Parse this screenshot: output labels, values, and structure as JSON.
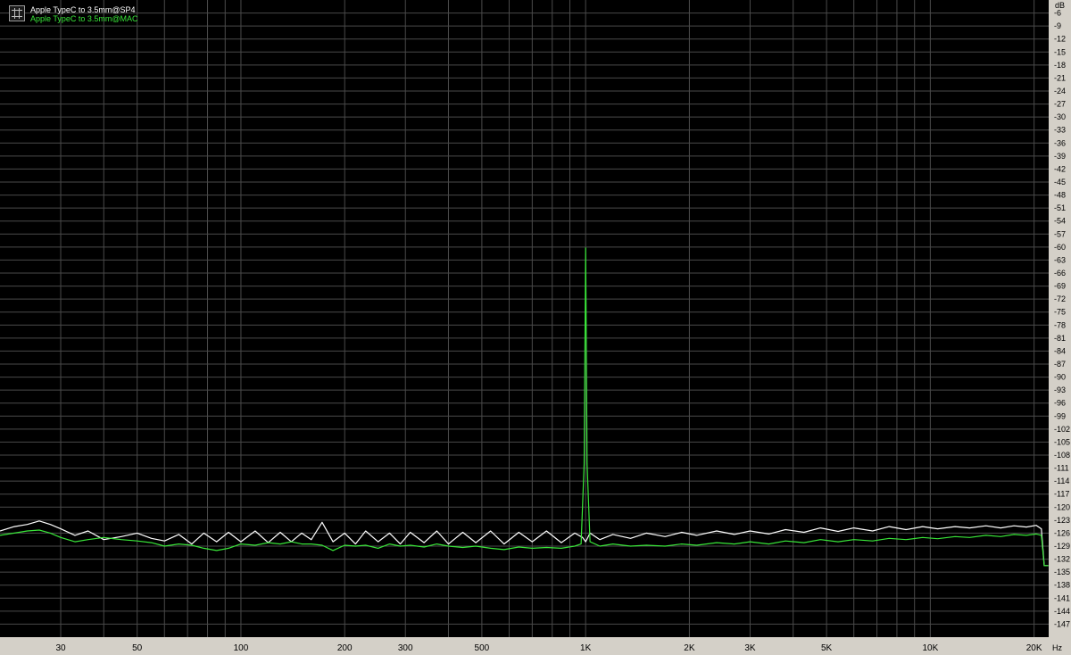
{
  "chart_data": {
    "type": "line",
    "title": "",
    "xlabel": "",
    "ylabel": "",
    "x_scale": "log",
    "xlim": [
      20,
      22050
    ],
    "ylim": [
      -150,
      -3
    ],
    "y_unit": "dB",
    "x_unit": "Hz",
    "grid": true,
    "legend": "top-left",
    "background": "#000000",
    "y_ticks": [
      -6,
      -9,
      -12,
      -15,
      -18,
      -21,
      -24,
      -27,
      -30,
      -33,
      -36,
      -39,
      -42,
      -45,
      -48,
      -51,
      -54,
      -57,
      -60,
      -63,
      -66,
      -69,
      -72,
      -75,
      -78,
      -81,
      -84,
      -87,
      -90,
      -93,
      -96,
      -99,
      -102,
      -105,
      -108,
      -111,
      -114,
      -117,
      -120,
      -123,
      -126,
      -129,
      -132,
      -135,
      -138,
      -141,
      -144,
      -147
    ],
    "x_ticks": [
      {
        "value": 30,
        "label": "30"
      },
      {
        "value": 50,
        "label": "50"
      },
      {
        "value": 100,
        "label": "100"
      },
      {
        "value": 200,
        "label": "200"
      },
      {
        "value": 300,
        "label": "300"
      },
      {
        "value": 500,
        "label": "500"
      },
      {
        "value": 1000,
        "label": "1K"
      },
      {
        "value": 2000,
        "label": "2K"
      },
      {
        "value": 3000,
        "label": "3K"
      },
      {
        "value": 5000,
        "label": "5K"
      },
      {
        "value": 10000,
        "label": "10K"
      },
      {
        "value": 20000,
        "label": "20K"
      }
    ],
    "series": [
      {
        "name": "Apple TypeC to 3.5mm@SP4",
        "color": "#ffffff",
        "points": [
          [
            20,
            -125.5
          ],
          [
            22,
            -124.5
          ],
          [
            24,
            -124
          ],
          [
            26,
            -123.2
          ],
          [
            28,
            -124
          ],
          [
            30,
            -125
          ],
          [
            33,
            -126.5
          ],
          [
            36,
            -125.5
          ],
          [
            40,
            -127.5
          ],
          [
            45,
            -126.8
          ],
          [
            50,
            -126
          ],
          [
            55,
            -127.2
          ],
          [
            60,
            -127.8
          ],
          [
            66,
            -126.3
          ],
          [
            72,
            -128.5
          ],
          [
            78,
            -126
          ],
          [
            85,
            -128
          ],
          [
            92,
            -125.8
          ],
          [
            100,
            -128
          ],
          [
            110,
            -125.5
          ],
          [
            120,
            -128.2
          ],
          [
            130,
            -125.8
          ],
          [
            140,
            -128
          ],
          [
            150,
            -126
          ],
          [
            160,
            -127.5
          ],
          [
            172,
            -123.5
          ],
          [
            185,
            -128
          ],
          [
            200,
            -126
          ],
          [
            215,
            -128.5
          ],
          [
            230,
            -125.5
          ],
          [
            250,
            -128
          ],
          [
            270,
            -126
          ],
          [
            290,
            -128.5
          ],
          [
            310,
            -125.8
          ],
          [
            340,
            -128.2
          ],
          [
            370,
            -125.5
          ],
          [
            400,
            -128.5
          ],
          [
            440,
            -125.8
          ],
          [
            480,
            -128.2
          ],
          [
            530,
            -125.5
          ],
          [
            580,
            -128.5
          ],
          [
            640,
            -125.8
          ],
          [
            700,
            -128
          ],
          [
            770,
            -125.5
          ],
          [
            850,
            -128.2
          ],
          [
            930,
            -126
          ],
          [
            980,
            -127
          ],
          [
            1000,
            -128
          ],
          [
            1030,
            -126
          ],
          [
            1100,
            -127.5
          ],
          [
            1200,
            -126.3
          ],
          [
            1350,
            -127.2
          ],
          [
            1500,
            -126
          ],
          [
            1700,
            -126.8
          ],
          [
            1900,
            -125.8
          ],
          [
            2100,
            -126.5
          ],
          [
            2400,
            -125.5
          ],
          [
            2700,
            -126.3
          ],
          [
            3000,
            -125.5
          ],
          [
            3400,
            -126.2
          ],
          [
            3800,
            -125.2
          ],
          [
            4300,
            -125.8
          ],
          [
            4800,
            -124.8
          ],
          [
            5400,
            -125.6
          ],
          [
            6000,
            -124.8
          ],
          [
            6800,
            -125.5
          ],
          [
            7600,
            -124.5
          ],
          [
            8500,
            -125.2
          ],
          [
            9500,
            -124.5
          ],
          [
            10500,
            -125
          ],
          [
            11800,
            -124.5
          ],
          [
            13000,
            -124.8
          ],
          [
            14500,
            -124.3
          ],
          [
            16000,
            -124.8
          ],
          [
            17500,
            -124.3
          ],
          [
            19000,
            -124.6
          ],
          [
            20300,
            -124.2
          ],
          [
            21000,
            -125
          ],
          [
            21400,
            -133.5
          ],
          [
            22000,
            -133.5
          ]
        ]
      },
      {
        "name": "Apple TypeC to 3.5mm@MAC",
        "color": "#39e639",
        "points": [
          [
            20,
            -126.5
          ],
          [
            22,
            -126
          ],
          [
            24,
            -125.5
          ],
          [
            26,
            -125.3
          ],
          [
            28,
            -126
          ],
          [
            30,
            -127
          ],
          [
            33,
            -128
          ],
          [
            36,
            -127.5
          ],
          [
            40,
            -127
          ],
          [
            45,
            -127.5
          ],
          [
            50,
            -127.8
          ],
          [
            55,
            -128.2
          ],
          [
            60,
            -129
          ],
          [
            66,
            -128.5
          ],
          [
            72,
            -128.8
          ],
          [
            78,
            -129.5
          ],
          [
            85,
            -130
          ],
          [
            92,
            -129.5
          ],
          [
            100,
            -128.5
          ],
          [
            110,
            -128.8
          ],
          [
            120,
            -128.2
          ],
          [
            130,
            -128.5
          ],
          [
            140,
            -128
          ],
          [
            150,
            -128.5
          ],
          [
            160,
            -128.5
          ],
          [
            172,
            -128.8
          ],
          [
            185,
            -130
          ],
          [
            200,
            -128.8
          ],
          [
            215,
            -129
          ],
          [
            230,
            -128.8
          ],
          [
            250,
            -129.5
          ],
          [
            270,
            -128.5
          ],
          [
            290,
            -129
          ],
          [
            310,
            -128.8
          ],
          [
            340,
            -129.2
          ],
          [
            370,
            -128.5
          ],
          [
            400,
            -129
          ],
          [
            440,
            -129.3
          ],
          [
            480,
            -129
          ],
          [
            530,
            -129.5
          ],
          [
            580,
            -129.8
          ],
          [
            640,
            -129.2
          ],
          [
            700,
            -129.5
          ],
          [
            770,
            -129.3
          ],
          [
            850,
            -129.5
          ],
          [
            930,
            -129
          ],
          [
            970,
            -128.5
          ],
          [
            990,
            -110
          ],
          [
            1000,
            -60.2
          ],
          [
            1010,
            -110
          ],
          [
            1030,
            -128
          ],
          [
            1100,
            -129
          ],
          [
            1200,
            -128.5
          ],
          [
            1350,
            -129
          ],
          [
            1500,
            -128.8
          ],
          [
            1700,
            -129
          ],
          [
            1900,
            -128.5
          ],
          [
            2100,
            -128.8
          ],
          [
            2400,
            -128.2
          ],
          [
            2700,
            -128.5
          ],
          [
            3000,
            -128
          ],
          [
            3400,
            -128.5
          ],
          [
            3800,
            -127.8
          ],
          [
            4300,
            -128.2
          ],
          [
            4800,
            -127.5
          ],
          [
            5400,
            -128
          ],
          [
            6000,
            -127.5
          ],
          [
            6800,
            -127.8
          ],
          [
            7600,
            -127.2
          ],
          [
            8500,
            -127.5
          ],
          [
            9500,
            -127
          ],
          [
            10500,
            -127.3
          ],
          [
            11800,
            -126.8
          ],
          [
            13000,
            -127
          ],
          [
            14500,
            -126.5
          ],
          [
            16000,
            -126.8
          ],
          [
            17500,
            -126.3
          ],
          [
            19000,
            -126.5
          ],
          [
            20300,
            -126.2
          ],
          [
            21000,
            -126.5
          ],
          [
            21400,
            -133.5
          ],
          [
            22000,
            -133.5
          ]
        ]
      }
    ]
  }
}
